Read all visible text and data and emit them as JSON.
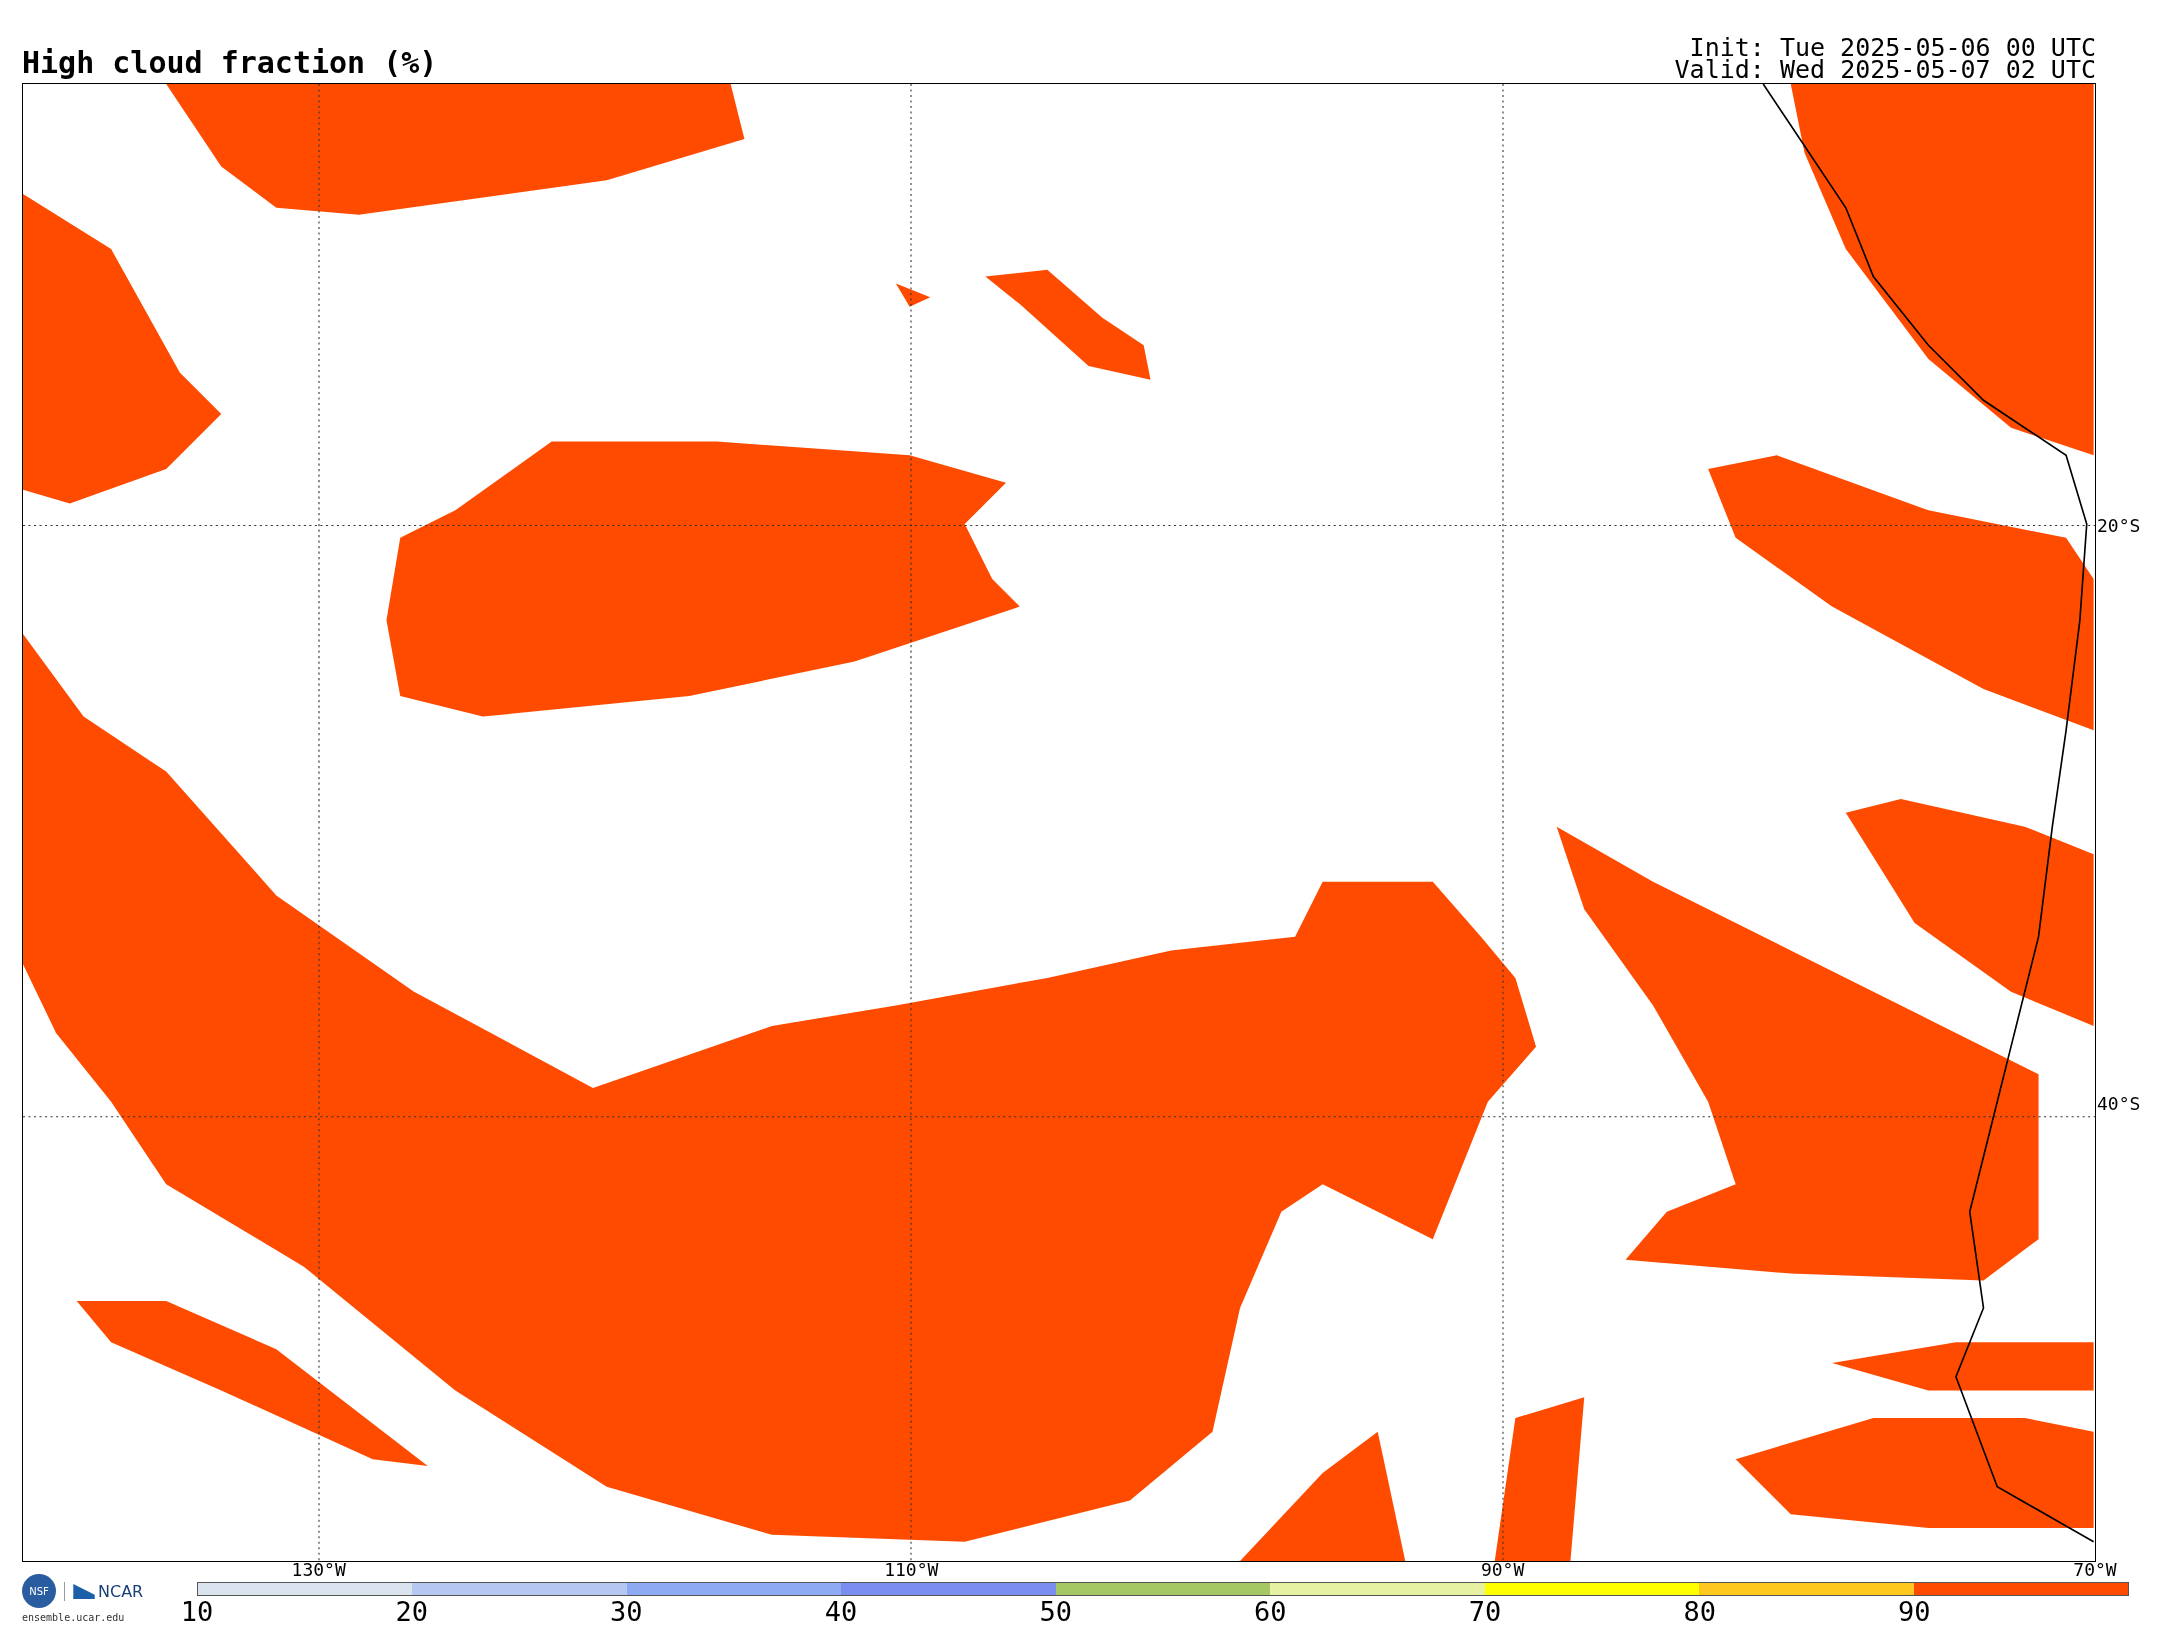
{
  "title": "High cloud fraction (%)",
  "run_info": [
    "Init: Tue 2025-05-06 00 UTC",
    "Valid: Wed 2025-05-07 02 UTC"
  ],
  "map": {
    "lat_labels": [
      {
        "label": "20°S"
      },
      {
        "label": "40°S"
      }
    ],
    "lon_labels": [
      {
        "label": "130°W"
      },
      {
        "label": "110°W"
      },
      {
        "label": "90°W"
      },
      {
        "label": "70°W"
      }
    ]
  },
  "logo": {
    "seal": "NSF",
    "name": "NCAR",
    "url": "ensemble.ucar.edu"
  },
  "colorbar": {
    "bins": [
      {
        "color": "#dbe4ee"
      },
      {
        "color": "#b4c8f2"
      },
      {
        "color": "#8eaaf2"
      },
      {
        "color": "#7a8ef0"
      },
      {
        "color": "#a6c864"
      },
      {
        "color": "#e6f2a2"
      },
      {
        "color": "#ffff00"
      },
      {
        "color": "#ffc81e"
      },
      {
        "color": "#ff4b00"
      }
    ],
    "ticks": [
      "10",
      "20",
      "30",
      "40",
      "50",
      "60",
      "70",
      "80",
      "90"
    ]
  }
}
